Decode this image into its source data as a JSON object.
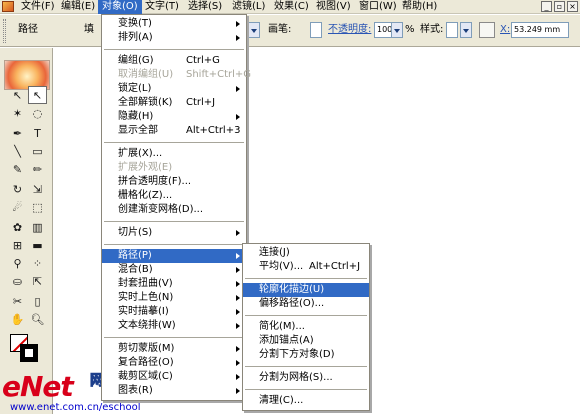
{
  "menubar": {
    "items": [
      "文件(F)",
      "编辑(E)",
      "对象(O)",
      "文字(T)",
      "选择(S)",
      "滤镜(L)",
      "效果(C)",
      "视图(V)",
      "窗口(W)",
      "帮助(H)"
    ],
    "active_index": 2
  },
  "controlbar": {
    "tool_label": "路径",
    "fill_label": "填",
    "stroke_label": "画笔:",
    "opacity_label": "不透明度:",
    "opacity_value": "100",
    "opacity_unit": "%",
    "style_label": "样式:",
    "x_label": "X:",
    "x_value": "53.249 mm"
  },
  "object_menu": {
    "items": [
      {
        "label": "变换(T)",
        "submenu": true
      },
      {
        "label": "排列(A)",
        "submenu": true
      },
      {
        "sep": true
      },
      {
        "label": "编组(G)",
        "shortcut": "Ctrl+G"
      },
      {
        "label": "取消编组(U)",
        "shortcut": "Shift+Ctrl+G",
        "disabled": true
      },
      {
        "label": "锁定(L)",
        "submenu": true
      },
      {
        "label": "全部解锁(K)",
        "shortcut": "Ctrl+J"
      },
      {
        "label": "隐藏(H)",
        "submenu": true
      },
      {
        "label": "显示全部",
        "shortcut": "Alt+Ctrl+3"
      },
      {
        "sep": true
      },
      {
        "label": "扩展(X)..."
      },
      {
        "label": "扩展外观(E)",
        "disabled": true
      },
      {
        "label": "拼合透明度(F)..."
      },
      {
        "label": "栅格化(Z)..."
      },
      {
        "label": "创建渐变网格(D)..."
      },
      {
        "sep": true
      },
      {
        "label": "切片(S)",
        "submenu": true
      },
      {
        "sep": true
      },
      {
        "label": "路径(P)",
        "submenu": true,
        "highlighted": true
      },
      {
        "label": "混合(B)",
        "submenu": true
      },
      {
        "label": "封套扭曲(V)",
        "submenu": true
      },
      {
        "label": "实时上色(N)",
        "submenu": true
      },
      {
        "label": "实时描摹(I)",
        "submenu": true
      },
      {
        "label": "文本绕排(W)",
        "submenu": true
      },
      {
        "sep": true
      },
      {
        "label": "剪切蒙版(M)",
        "submenu": true
      },
      {
        "label": "复合路径(O)",
        "submenu": true
      },
      {
        "label": "裁剪区域(C)",
        "submenu": true
      },
      {
        "label": "图表(R)",
        "submenu": true
      }
    ]
  },
  "path_menu": {
    "items": [
      {
        "label": "连接(J)"
      },
      {
        "label": "平均(V)...",
        "shortcut": "Alt+Ctrl+J"
      },
      {
        "sep": true
      },
      {
        "label": "轮廓化描边(U)",
        "highlighted": true
      },
      {
        "label": "偏移路径(O)..."
      },
      {
        "sep": true
      },
      {
        "label": "简化(M)..."
      },
      {
        "label": "添加锚点(A)"
      },
      {
        "label": "分割下方对象(D)"
      },
      {
        "sep": true
      },
      {
        "label": "分割为网格(S)..."
      },
      {
        "sep": true
      },
      {
        "label": "清理(C)..."
      }
    ]
  },
  "tools": [
    "selection-tool",
    "direct-selection-tool",
    "magic-wand-tool",
    "lasso-tool",
    "pen-tool",
    "type-tool",
    "line-tool",
    "rectangle-tool",
    "paintbrush-tool",
    "pencil-tool",
    "rotate-tool",
    "scale-tool",
    "warp-tool",
    "free-transform-tool",
    "symbol-sprayer-tool",
    "graph-tool",
    "mesh-tool",
    "gradient-tool",
    "eyedropper-tool",
    "blend-tool",
    "live-paint-tool",
    "live-paint-selection-tool",
    "slice-tool",
    "eraser-tool",
    "hand-tool",
    "zoom-tool"
  ],
  "watermark": {
    "logo": "eNet",
    "cn": "网络学院",
    "url": "www.enet.com.cn/eschool"
  }
}
